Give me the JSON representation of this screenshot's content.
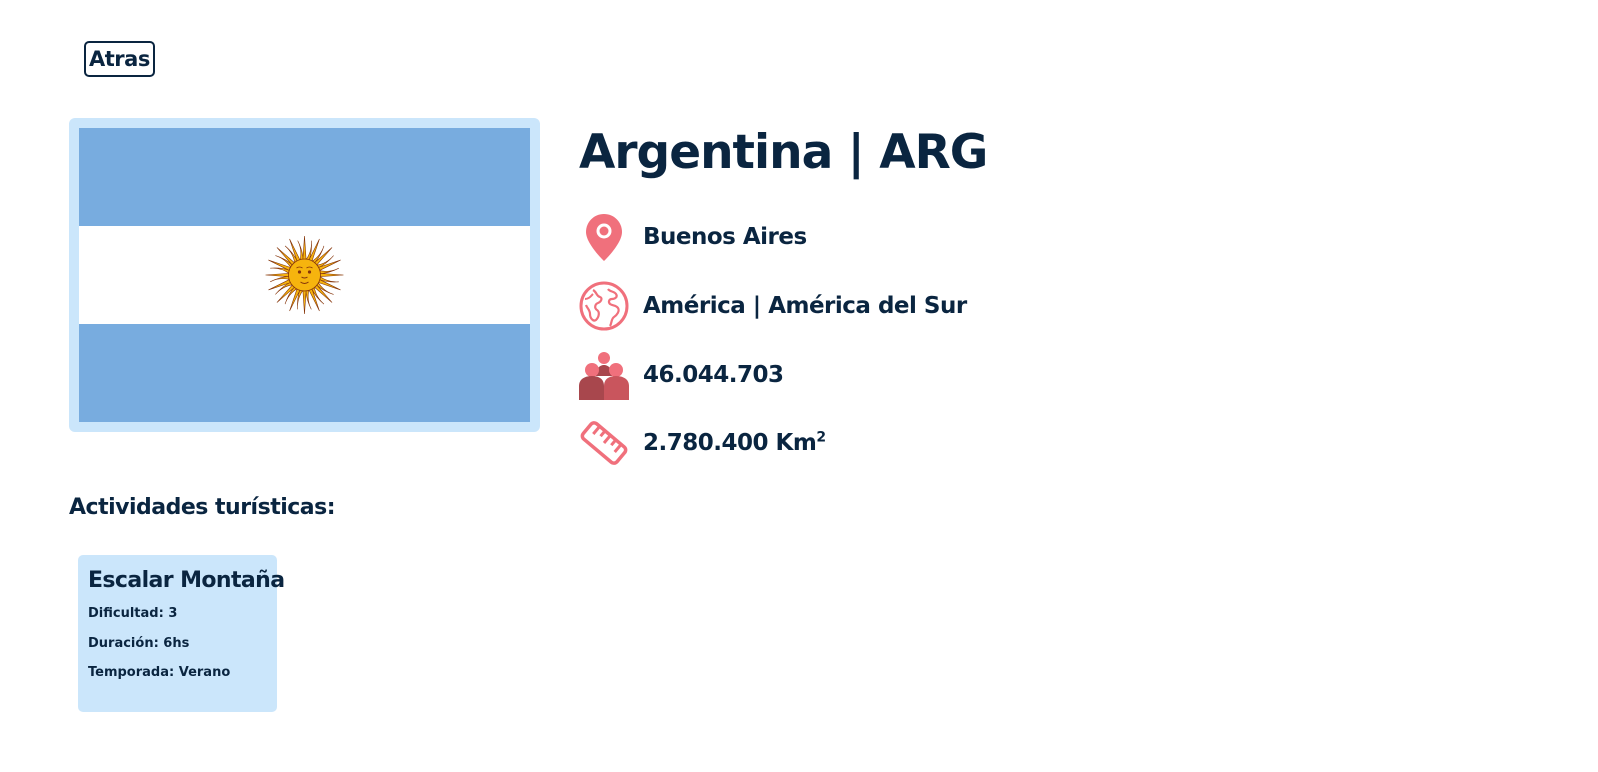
{
  "back_button": {
    "label": "Atras"
  },
  "country": {
    "name": "Argentina",
    "separator": "|",
    "code": "ARG",
    "capital": "Buenos Aires",
    "region": "América",
    "subregion": "América del Sur",
    "population": "46.044.703",
    "area": "2.780.400",
    "area_unit": "Km",
    "area_unit_sup": "2"
  },
  "icons": {
    "capital": "map-pin-icon",
    "region": "globe-icon",
    "population": "people-icon",
    "area": "ruler-icon"
  },
  "colors": {
    "text": "#0a2540",
    "accent": "#f0707c",
    "card_bg": "#cbe6fb",
    "flag_blue": "#78acdf",
    "flag_sun": "#f4b223"
  },
  "activities": {
    "heading": "Actividades turísticas:",
    "items": [
      {
        "name": "Escalar Montaña",
        "difficulty": "Dificultad: 3",
        "duration": "Duración: 6hs",
        "season": "Temporada: Verano"
      }
    ]
  }
}
